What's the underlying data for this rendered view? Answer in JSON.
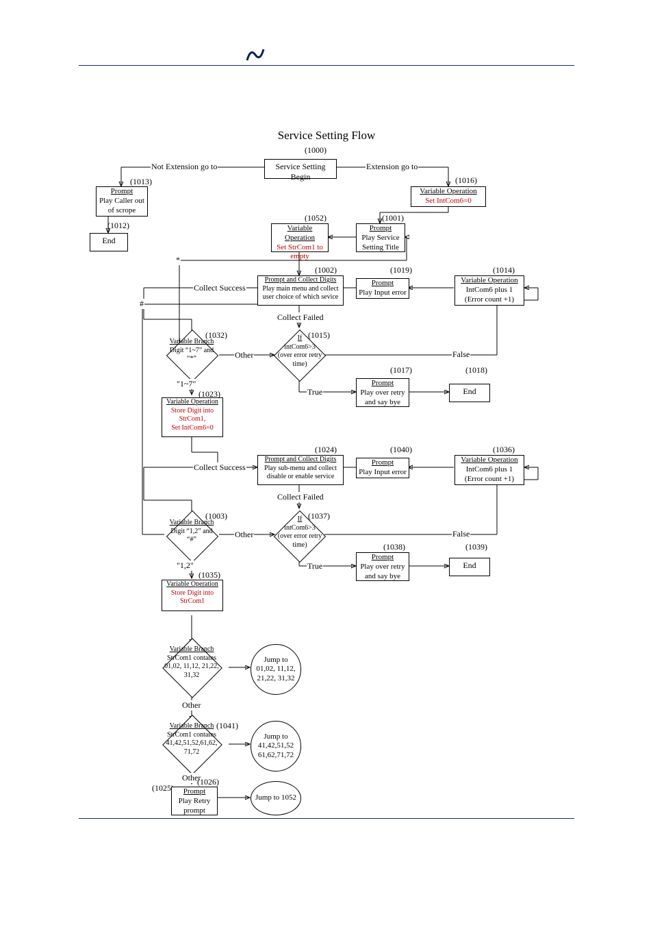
{
  "title": "Service Setting Flow",
  "ids": {
    "n1000": "(1000)",
    "n1013": "(1013)",
    "n1012": "(1012)",
    "n1016": "(1016)",
    "n1052": "(1052)",
    "n1001": "(1001)",
    "n1002": "(1002)",
    "n1019": "(1019)",
    "n1014": "(1014)",
    "n1032": "(1032)",
    "n1015": "(1015)",
    "n1017": "(1017)",
    "n1018": "(1018)",
    "n1023": "(1023)",
    "n1024": "(1024)",
    "n1040": "(1040)",
    "n1036": "(1036)",
    "n1003": "(1003)",
    "n1037": "(1037)",
    "n1038": "(1038)",
    "n1039": "(1039)",
    "n1035": "(1035)",
    "n1041": "(1041)",
    "n1025": "(1025)",
    "n1026": "(1026)"
  },
  "n1000": {
    "l1": "Service Setting Begin"
  },
  "n1013": {
    "h": "Prompt",
    "l1": "Play Caller out",
    "l2": "of scrope"
  },
  "n1012": {
    "l1": "End"
  },
  "n1016": {
    "h": "Variable Operation",
    "l1": "Set IntCom6=0"
  },
  "n1052": {
    "h": "Variable Operation",
    "l1": "Set StrCom1 to",
    "l2": "empty"
  },
  "n1001": {
    "h": "Prompt",
    "l1": "Play Service",
    "l2": "Setting Title"
  },
  "n1002": {
    "h": "Prompt and Collect Digits",
    "l1": "Play main menu and collect",
    "l2": "user choice of which sevice"
  },
  "n1019": {
    "h": "Prompt",
    "l1": "Play Input error"
  },
  "n1014": {
    "h": "Variable Operation",
    "l1": "IntCom6 plus 1",
    "l2": "(Error count +1)"
  },
  "n1032": {
    "h": "Variable Branch",
    "l1": "Digit “1~7” and",
    "l2": "“*”"
  },
  "n1015": {
    "h": "If",
    "l1": "intCom6>3",
    "l2": "(over error retry",
    "l3": "time)"
  },
  "n1017": {
    "h": "Prompt",
    "l1": "Play over retry",
    "l2": "and say bye"
  },
  "n1018": {
    "l1": "End"
  },
  "n1023": {
    "h": "Variable Operation",
    "l1": "Store Digit into",
    "l2": "StrCom1,",
    "l3": "Set IntCom6=0"
  },
  "n1024": {
    "h": "Prompt and Collect Digits",
    "l1": "Play sub-menu and collect",
    "l2": "disable or enable service"
  },
  "n1040": {
    "h": "Prompt",
    "l1": "Play Input error"
  },
  "n1036": {
    "h": "Variable Operation",
    "l1": "IntCom6 plus 1",
    "l2": "(Error count +1)"
  },
  "n1003": {
    "h": "Variable Branch",
    "l1": "Digit “1,2” and",
    "l2": "“#”"
  },
  "n1037": {
    "h": "If",
    "l1": "intCom6>3",
    "l2": "(over error retry",
    "l3": "time)"
  },
  "n1038": {
    "h": "Prompt",
    "l1": "Play over retry",
    "l2": "and say bye"
  },
  "n1039": {
    "l1": "End"
  },
  "n1035": {
    "h": "Variable Operation",
    "l1": "Store Digit into",
    "l2": "StrCom1"
  },
  "vb1": {
    "h": "Variable Branch",
    "l1": "StrCom1 contains",
    "l2": "01,02, 11,12, 21,22,",
    "l3": "31,32"
  },
  "j1": {
    "l1": "Jump to",
    "l2": "01,02, 11,12,",
    "l3": "21,22, 31,32"
  },
  "n1041": {
    "h": "Variable Branch",
    "l1": "StrCom1 contains",
    "l2": "41,42,51,52,61,62,",
    "l3": "71,72"
  },
  "j2": {
    "l1": "Jump to",
    "l2": "41,42,51,52",
    "l3": "61,62,71,72"
  },
  "n1026": {
    "h": "Prompt",
    "l1": "Play Retry",
    "l2": "prompt"
  },
  "j3": {
    "l1": "Jump to 1052"
  },
  "edges": {
    "notExt": "Not Extension go to",
    "ext": "Extension go to",
    "collSucc": "Collect Success",
    "collFail": "Collect Failed",
    "other": "Other",
    "true": "True",
    "false": "False",
    "d17": "\"1~7\"",
    "d12": "\"1,2\"",
    "star": "*",
    "hash": "#"
  }
}
